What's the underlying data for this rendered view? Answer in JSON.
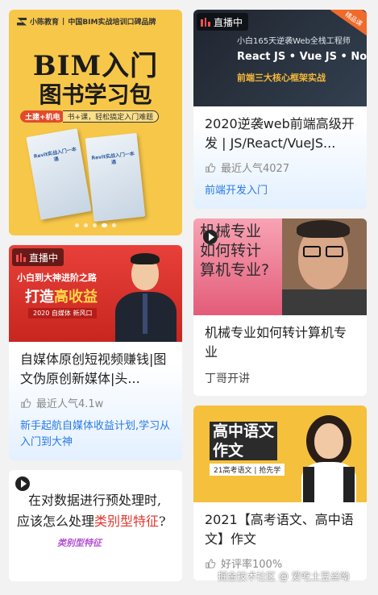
{
  "left_column": {
    "bim_banner": {
      "brand": "小陈教育",
      "brand_slogan": "中国BIM实战培训口碑品牌",
      "headline_1": "BIM入门",
      "headline_2": "图书学习包",
      "pill_tag": "土建+机电",
      "pill_text": "书+课，轻松搞定入门难题",
      "book_1_title": "Revit实战入门一本通",
      "book_2_title": "Revit实战入门一本通"
    },
    "self_media_card": {
      "live_label": "直播中",
      "banner_line_1": "小白到大神进阶之路",
      "banner_line_2_prefix": "打造",
      "banner_line_2_highlight": "高收益",
      "banner_line_3": "2020 自媒体 新风口",
      "title": "自媒体原创短视频赚钱|图文伪原创新媒体|头...",
      "popularity": "最近人气4.1w",
      "tag": "新手起航自媒体收益计划,学习从入门到大神"
    },
    "data_prep_card": {
      "line_1": "在对数据进行预处理时,",
      "line_2_prefix": "应该怎么处理",
      "line_2_highlight": "类别型特征",
      "line_2_suffix": "?",
      "sticker": "类别型特征"
    }
  },
  "right_column": {
    "web_card": {
      "live_label": "直播中",
      "banner_line_1": "小白165天逆袭Web全栈工程师",
      "banner_line_2": "React JS • Vue JS • Node JS",
      "banner_line_3": "前端三大核心框架实战",
      "corner_badge": "精品课",
      "title": "2020逆袭web前端高级开发 | JS/React/VueJS...",
      "popularity": "最近人气4027",
      "tag": "前端开发入门"
    },
    "mech_card": {
      "banner_text_1": "机械专业",
      "banner_text_2": "如何转计",
      "banner_text_3": "算机专业?",
      "title": "机械专业如何转计算机专业",
      "author": "丁哥开讲"
    },
    "chinese_card": {
      "banner_line_1": "高中语文",
      "banner_line_2": "作文",
      "banner_tag": "21高考语文 | 抢先学",
      "title": "2021【高考语文、高中语文】作文",
      "rating": "好评率100%"
    }
  },
  "watermark": "掘金技术社区 @ 爱吃土豆丝呦",
  "colors": {
    "accent_blue": "#2a7be4",
    "live_red": "#ff4d4f",
    "bim_yellow": "#f7c749"
  }
}
